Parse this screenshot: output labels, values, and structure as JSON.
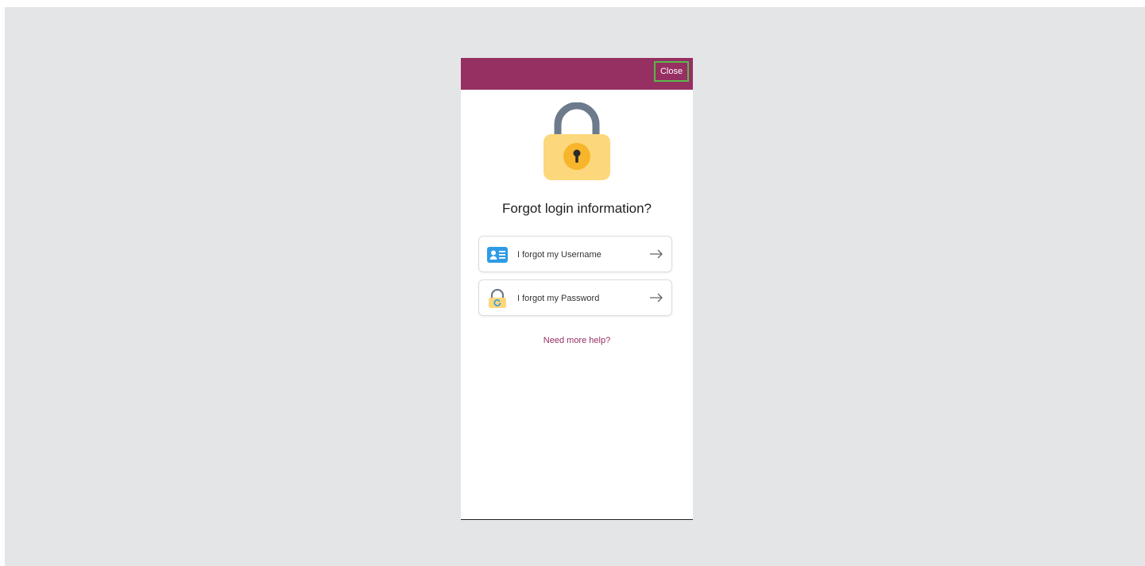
{
  "header": {
    "close_label": "Close"
  },
  "main": {
    "title": "Forgot login information?",
    "options": [
      {
        "label": "I forgot my Username",
        "icon": "id-card-icon"
      },
      {
        "label": "I forgot my Password",
        "icon": "lock-reset-icon"
      }
    ],
    "help_link": "Need more help?"
  },
  "colors": {
    "brand": "#962f62",
    "highlight_border": "#58b94a",
    "lock_body": "#fdd77b",
    "lock_shackle": "#6c7a8c",
    "keyhole_circle": "#f7b52b",
    "id_card": "#2f9be6"
  }
}
